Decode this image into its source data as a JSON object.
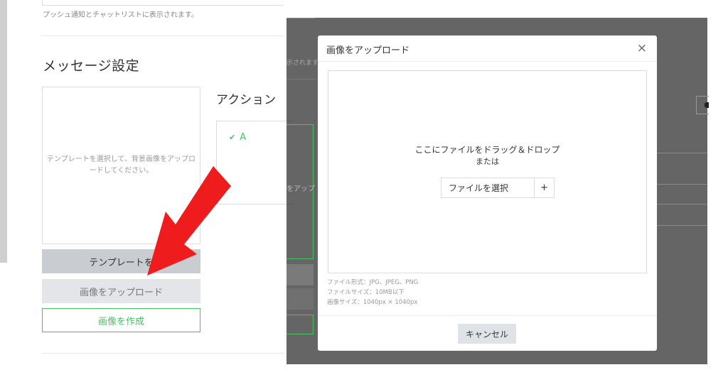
{
  "page": {
    "push_hint": "プッシュ通知とチャットリストに表示されます。",
    "section_title": "メッセージ設定",
    "preview_placeholder": "テンプレートを選択して、背景画像をアップロードしてください。",
    "buttons": {
      "template": "テンプレートを",
      "upload": "画像をアップロード",
      "create": "画像を作成"
    },
    "action": {
      "title": "アクション",
      "item_label": "A"
    },
    "underlay_fragments": {
      "hint_fragment": "示されます",
      "upload_fragment": "をアップ"
    }
  },
  "modal": {
    "title": "画像をアップロード",
    "close_symbol": "×",
    "drop_line1": "ここにファイルをドラッグ＆ドロップ",
    "drop_line2": "または",
    "file_button": "ファイルを選択",
    "plus_symbol": "+",
    "info": {
      "format": "ファイル形式：JPG、JPEG、PNG",
      "size": "ファイルサイズ：10MB以下",
      "dimensions": "画像サイズ：1040px × 1040px"
    },
    "cancel": "キャンセル"
  },
  "colors": {
    "accent_green": "#46c35f",
    "arrow_red": "#ee1c1c",
    "overlay": "#3a3a3a"
  },
  "annotation": {
    "arrow": "red-arrow-pointing-to-upload-button"
  }
}
